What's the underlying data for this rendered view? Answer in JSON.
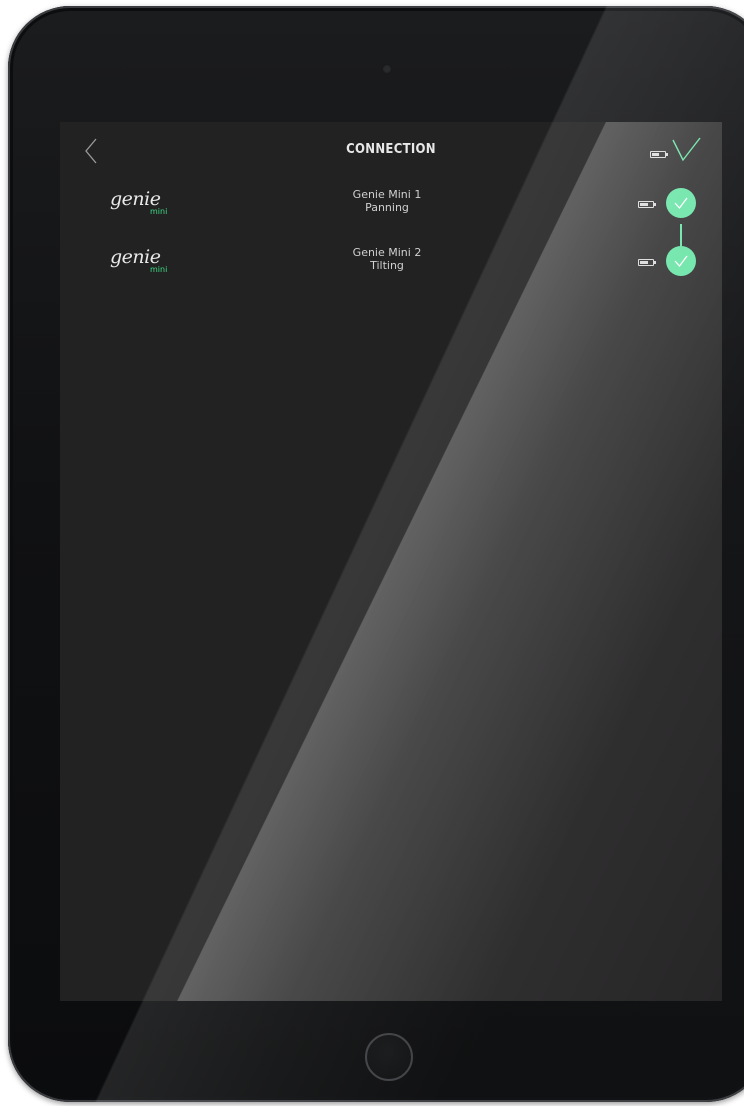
{
  "header": {
    "title": "CONNECTION",
    "back_icon": "chevron-left-icon",
    "battery_icon": "battery-icon",
    "confirm_icon": "check-icon",
    "battery_level": 0.6
  },
  "devices": [
    {
      "logo_text": "genie",
      "logo_sub": "mini",
      "name": "Genie Mini 1",
      "mode": "Panning",
      "battery_level": 0.7,
      "connected": true
    },
    {
      "logo_text": "genie",
      "logo_sub": "mini",
      "name": "Genie Mini 2",
      "mode": "Tilting",
      "battery_level": 0.7,
      "connected": true
    }
  ],
  "colors": {
    "accent": "#5fe3a0",
    "logo_accent": "#3ddc84",
    "screen_bg": "#232223",
    "text": "#e8e8e8"
  }
}
